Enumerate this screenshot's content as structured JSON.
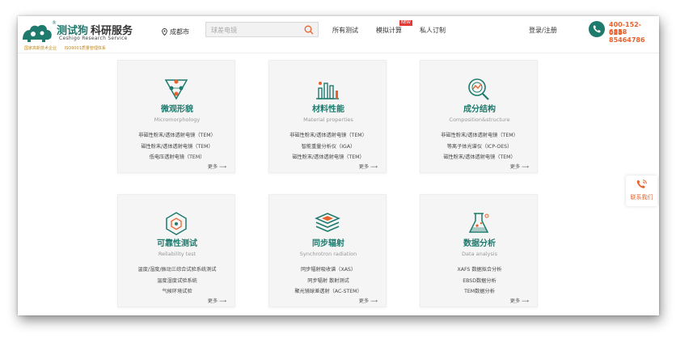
{
  "brand": {
    "name_cn": "测试狗",
    "name_suffix": "科研服务",
    "registered": "®",
    "name_en": "Ceshigo Research Service",
    "badges": [
      "国家高新技术企业",
      "ISO9001质量管理体系"
    ]
  },
  "header": {
    "location": "成都市",
    "search_placeholder": "球差电镜",
    "nav": [
      {
        "label": "所有测试"
      },
      {
        "label": "模拟计算",
        "badge": "NEW"
      },
      {
        "label": "私人订制"
      }
    ],
    "login": "登录/注册",
    "phones": [
      "400-152-6858",
      "028-85464786"
    ]
  },
  "cards": [
    {
      "title": "微观形貌",
      "subtitle": "Micromorphology",
      "items": [
        "非磁性粉末/透体透射电镜（TEM）",
        "磁性粉末/透体透射电镜（TEM）",
        "低电压透射电镜（TEM）"
      ],
      "more": "更多 ⟶",
      "icon": "microscope-triangle-icon"
    },
    {
      "title": "材料性能",
      "subtitle": "Material properties",
      "items": [
        "非磁性粉末/透体透射电镜（TEM）",
        "智能重量分析仪（IGA）",
        "磁性粉末/透体透射电镜（TEM）"
      ],
      "more": "更多 ⟶",
      "icon": "bar-chart-icon"
    },
    {
      "title": "成分结构",
      "subtitle": "Composition&structure",
      "items": [
        "非磁性粉末/透体透射电镜（TEM）",
        "等离子体光谱仪（ICP-OES）",
        "磁性粉末/透体透射电镜（TEM）"
      ],
      "more": "更多 ⟶",
      "icon": "magnifier-icon"
    },
    {
      "title": "可靠性测试",
      "subtitle": "Reliability test",
      "items": [
        "温度/湿度/振动三综合试验系统测试",
        "温度湿度试验系统",
        "气候环境试验"
      ],
      "more": "更多 ⟶",
      "icon": "hexagon-network-icon"
    },
    {
      "title": "同步辐射",
      "subtitle": "Synchrotron radiation",
      "items": [
        "同步辐射吸收谱（XAS）",
        "同步辐射 散射测试",
        "聚光镜球差透射（AC-STEM）"
      ],
      "more": "更多 ⟶",
      "icon": "layers-icon"
    },
    {
      "title": "数据分析",
      "subtitle": "Data analysis",
      "items": [
        "XAFS 数据拟合分析",
        "EBSD数据分析",
        "TEM数据分析"
      ],
      "more": "更多 ⟶",
      "icon": "flask-icon"
    }
  ],
  "contact": {
    "label": "联系我们"
  },
  "colors": {
    "primary": "#1f7a6e",
    "accent": "#e8622c",
    "card_bg": "#f5f5f5"
  }
}
